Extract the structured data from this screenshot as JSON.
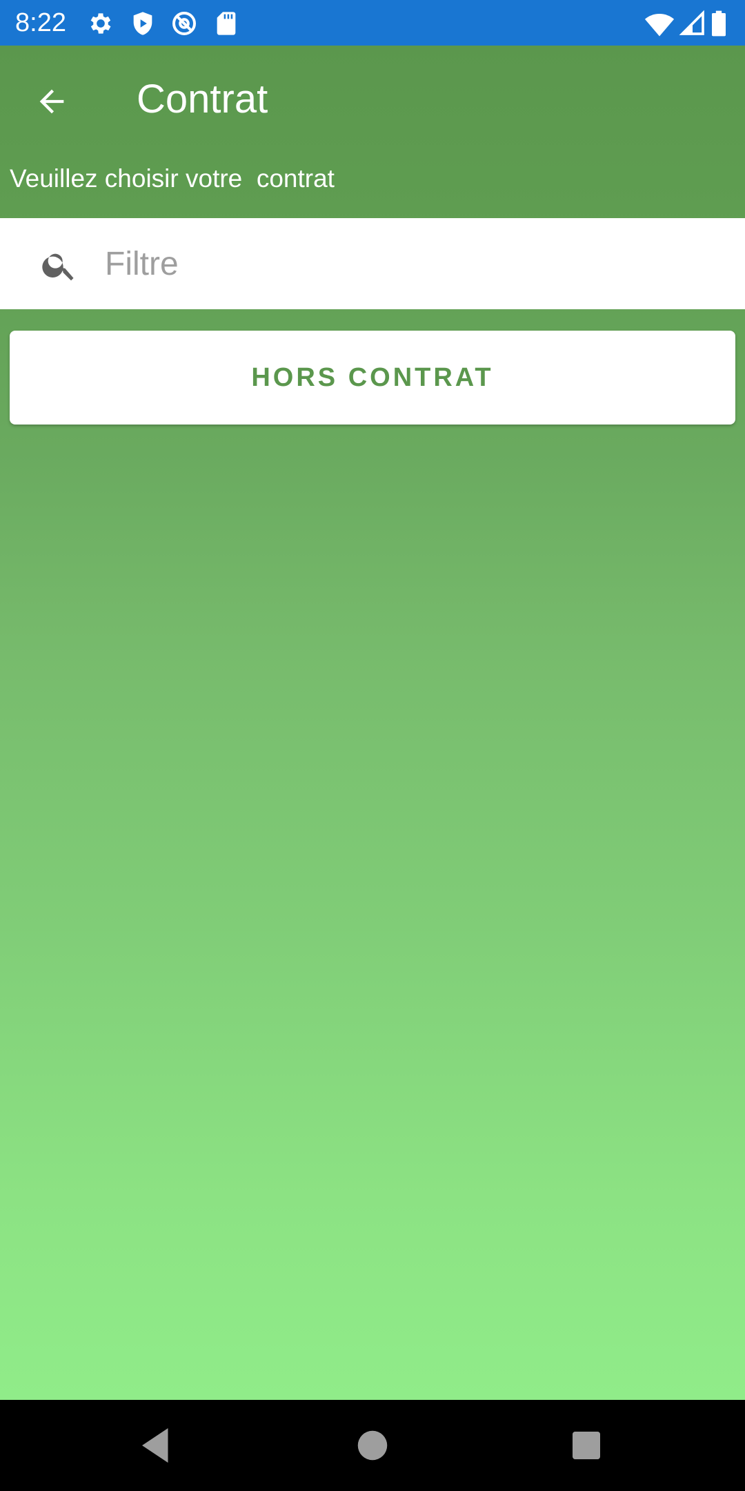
{
  "status_bar": {
    "time": "8:22",
    "background_color": "#1976d2",
    "left_icons": [
      "gear-icon",
      "shield-play-icon",
      "at-sign-icon",
      "sd-card-icon"
    ],
    "right_icons": [
      "wifi-icon",
      "cell-signal-icon",
      "battery-icon"
    ]
  },
  "toolbar": {
    "back_icon": "arrow-back-icon",
    "title": "Contrat",
    "subtitle": "Veuillez choisir votre  contrat"
  },
  "search": {
    "icon": "search-icon",
    "placeholder": "Filtre",
    "value": ""
  },
  "contracts": {
    "items": [
      {
        "label": "HORS CONTRAT"
      }
    ]
  },
  "theme": {
    "accent": "#5b974d",
    "gradient_top": "#5b974d",
    "gradient_bottom": "#90ec89"
  },
  "nav_bar": {
    "buttons": [
      "back-triangle-icon",
      "home-circle-icon",
      "recents-square-icon"
    ]
  }
}
